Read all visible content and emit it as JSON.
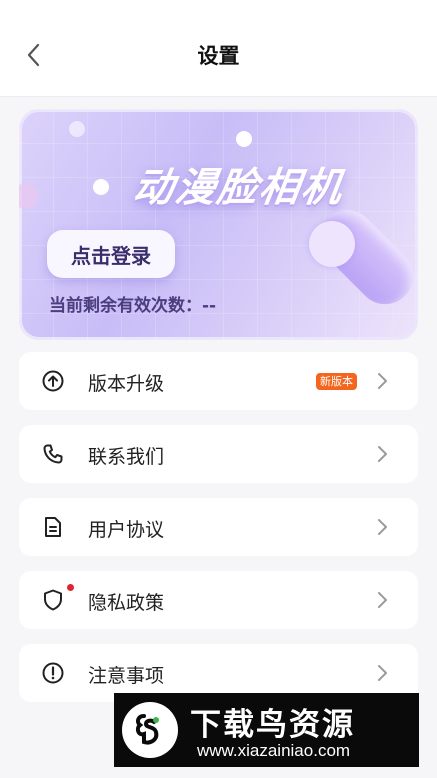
{
  "header": {
    "title": "设置",
    "back_icon": "chevron-left-icon"
  },
  "banner": {
    "brand_title": "动漫脸相机",
    "login_label": "点击登录",
    "remaining_label": "当前剩余有效次数：",
    "remaining_value": "--",
    "accent_colors": [
      "#c8bdf7",
      "#b9a3f5",
      "#4b3d7f"
    ]
  },
  "menu": [
    {
      "label": "版本升级",
      "icon": "upgrade-arrow-icon",
      "badge": "新版本"
    },
    {
      "label": "联系我们",
      "icon": "phone-icon"
    },
    {
      "label": "用户协议",
      "icon": "document-icon"
    },
    {
      "label": "隐私政策",
      "icon": "shield-icon",
      "dot": true
    },
    {
      "label": "注意事项",
      "icon": "alert-circle-icon"
    }
  ],
  "watermark": {
    "name": "下载鸟资源",
    "url": "www.xiazainiao.com"
  },
  "colors": {
    "badge": "#f4661e",
    "dot": "#e0242e",
    "background": "#f6f6f8"
  }
}
